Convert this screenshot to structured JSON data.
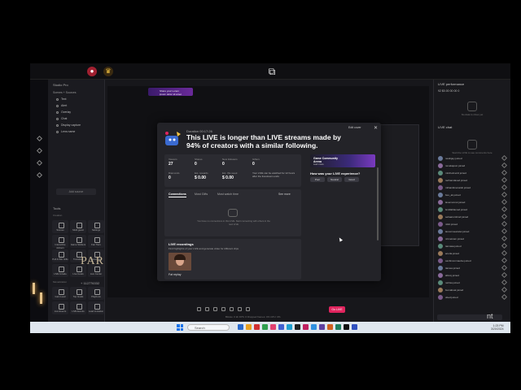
{
  "app": {
    "top_tiny_text": "",
    "promo_text": "Share your Lorem ipsum dolor sit amet"
  },
  "left_panel": {
    "header": "Studio Pro",
    "scene_label": "Scenes + Sources",
    "sources": [
      "Text",
      "Alert",
      "Overlay",
      "Chat",
      "Display capture",
      "Lens name"
    ],
    "add_source": "Add source",
    "tools_title": "Tools",
    "categories": [
      "Creation",
      "Monetization"
    ],
    "tools": [
      "Scenes",
      "Multi guest",
      "Settings",
      "Interactive stickers",
      "Game Stickers",
      "Fan Tiers",
      "Pull & Win Gifts",
      "Transition",
      "Guest Join",
      "LIVE Arcade",
      "Live Goals",
      "Live Center",
      "Gain Lead",
      "Top Goals",
      "Playbook",
      "Live Events",
      "LIVE Events",
      "Lead Invitation"
    ]
  },
  "preview": {
    "title_text": "PAR",
    "subtitle_text": "+ 112776332"
  },
  "modal": {
    "duration": "Duration 00:17:26",
    "headline": "This LIVE is longer than LIVE streams made by 94% of creators with a similar following.",
    "edit_cover": "Edit cover",
    "close": "✕",
    "stats": [
      {
        "label": "Viewers",
        "value": "27"
      },
      {
        "label": "Shares",
        "value": "0"
      },
      {
        "label": "New followers",
        "value": "0"
      },
      {
        "label": "Gifters",
        "value": "0"
      },
      {
        "label": "Diamonds",
        "value": "0"
      },
      {
        "label": "Est. rewards",
        "value": "$ 0.00"
      },
      {
        "label": "Est. this week",
        "value": "$ 0.00"
      }
    ],
    "stat_note": "Your LIVE can be watched for 12 hours after the livestream ends",
    "arena": {
      "title": "Game Community Arena",
      "sub": "Learn more"
    },
    "feedback_question": "How was your LIVE experience?",
    "feedback_options": [
      "Poor",
      "Neutral",
      "Good"
    ],
    "tabs": [
      "Connections",
      "Most Gifts",
      "Most watch time"
    ],
    "see_more": "See more",
    "empty_text": "You have no connections in this LIVE. Start connecting with others in the next LIVE",
    "recordings_title": "LIVE recordings",
    "recordings_sub": "Find highlights of your LIVE and generate video for different clips",
    "recording_name": "Fat replay"
  },
  "right_panel": {
    "performance_title": "LIVE performance",
    "stats_line": "92  $0.00  00  00  0",
    "empty_text": "No data to show yet",
    "chat_title": "LIVE chat",
    "chat_empty": "Start the LIVE to see comments here",
    "chat_users": [
      "newliguy joined",
      "nevekajoun joined",
      "mitchelmerid joined",
      "rachamdaved joined",
      "mihandimenatob joined",
      "beu_ak joined",
      "lavemonnut joined",
      "lsmillahlamed joined",
      "sebaarumbrud joined",
      "nitkit joined",
      "lanvermeanulet joined",
      "nrimetnam joined",
      "tannasa joined",
      "acurla joined",
      "sanbimonmaelve joined",
      "tiamea joined",
      "abtcoj joined",
      "nehisa joined",
      "bumabuat joined",
      "obed joined",
      "imanoko joined",
      "pu joined",
      "stefans joined",
      "pilosl joined",
      "ntemen joined"
    ]
  },
  "bottombar": {
    "go_live": "Go LIVE",
    "status": "Bitrate: 0 kb  FPS: 0  Dropped frames: 0%  CPU: 0%"
  },
  "taskbar": {
    "search_placeholder": "Search",
    "weather": "",
    "time": "1:23 PM",
    "date": "3/20/2024"
  },
  "background_text": "nt"
}
